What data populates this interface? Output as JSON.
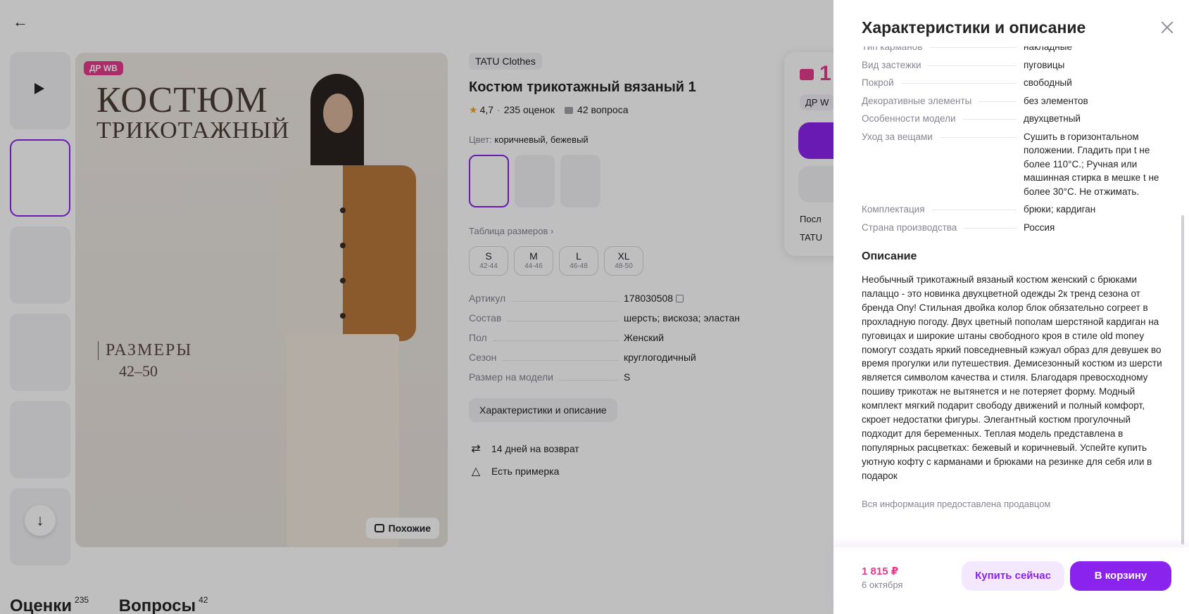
{
  "product": {
    "badge": "ДР WB",
    "photo_title_line1": "КОСТЮМ",
    "photo_title_line2": "ТРИКОТАЖНЫЙ",
    "photo_sizes_label": "РАЗМЕРЫ",
    "photo_sizes_range": "42–50",
    "similar_label": "Похожие",
    "brand": "TATU Clothes",
    "title": "Костюм трикотажный вязаный 1",
    "rating": "4,7",
    "reviews": "235 оценок",
    "questions": "42 вопроса",
    "color_label": "Цвет:",
    "color_value": "коричневый, бежевый",
    "size_table_label": "Таблица размеров",
    "sizes": [
      {
        "size": "S",
        "range": "42-44"
      },
      {
        "size": "M",
        "range": "44-46"
      },
      {
        "size": "L",
        "range": "46-48"
      },
      {
        "size": "XL",
        "range": "48-50"
      }
    ],
    "props": [
      {
        "key": "Артикул",
        "value": "178030508"
      },
      {
        "key": "Состав",
        "value": "шерсть; вискоза; эластан"
      },
      {
        "key": "Пол",
        "value": "Женский"
      },
      {
        "key": "Сезон",
        "value": "круглогодичный"
      },
      {
        "key": "Размер на модели",
        "value": "S"
      }
    ],
    "char_button": "Характеристики и описание",
    "perks": [
      {
        "icon": "return-arrows-icon",
        "label": "14 дней на возврат"
      },
      {
        "icon": "hanger-icon",
        "label": "Есть примерка"
      }
    ]
  },
  "buy_card": {
    "price_fragment": "1",
    "dr_chip": "ДР W",
    "line1": "Посл",
    "line2": "TATU"
  },
  "tabs": {
    "reviews_label": "Оценки",
    "reviews_count": "235",
    "questions_label": "Вопросы",
    "questions_count": "42"
  },
  "drawer": {
    "title": "Характеристики и описание",
    "cut_row": {
      "key": "Тип карманов",
      "value": "накладные"
    },
    "props": [
      {
        "key": "Вид застежки",
        "value": "пуговицы"
      },
      {
        "key": "Покрой",
        "value": "свободный"
      },
      {
        "key": "Декоративные элементы",
        "value": "без элементов"
      },
      {
        "key": "Особенности модели",
        "value": "двухцветный"
      },
      {
        "key": "Уход за вещами",
        "value": "Сушить в горизонтальном положении. Гладить при t не более 110°С.; Ручная или машинная стирка в мешке t не более 30°С. Не отжимать."
      },
      {
        "key": "Комплектация",
        "value": "брюки; кардиган"
      },
      {
        "key": "Страна производства",
        "value": "Россия"
      }
    ],
    "description_title": "Описание",
    "description": "Необычный трикотажный вязаный костюм женский с брюками палаццо - это новинка двухцветной одежды 2к тренд сезона от бренда Ony! Стильная двойка колор блок обязательно согреет в прохладную погоду. Двух цветный пополам шерстяной кардиган на пуговицах и широкие штаны свободного кроя в стиле old money помогут создать яркий повседневный кэжуал образ для девушек во время прогулки или путешествия. Демисезонный костюм из шерсти является символом качества и стиля. Благодаря превосходному пошиву трикотаж не вытянется и не потеряет форму. Модный комплект мягкий подарит свободу движений и полный комфорт, скроет недостатки фигуры. Элегантный костюм прогулочный подходит для беременных. Теплая модель представлена в популярных расцветках: бежевый и коричневый. Успейте купить уютную кофту с карманами и брюками на резинке для себя или в подарок",
    "seller_note": "Вся информация предоставлена продавцом",
    "footer": {
      "price": "1 815 ₽",
      "date": "6 октября",
      "buy_now": "Купить сейчас",
      "add_to_cart": "В корзину"
    }
  },
  "colors": {
    "accent": "#8b23ee",
    "price": "#e43b8d"
  }
}
